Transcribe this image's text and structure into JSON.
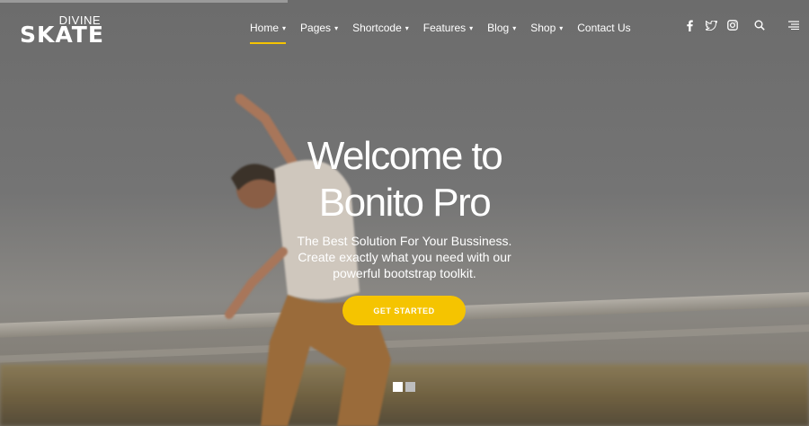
{
  "brand": {
    "top": "DIVINE",
    "main": "SKATE"
  },
  "nav": {
    "items": [
      {
        "label": "Home",
        "dropdown": true,
        "active": true
      },
      {
        "label": "Pages",
        "dropdown": true
      },
      {
        "label": "Shortcode",
        "dropdown": true
      },
      {
        "label": "Features",
        "dropdown": true
      },
      {
        "label": "Blog",
        "dropdown": true
      },
      {
        "label": "Shop",
        "dropdown": true
      },
      {
        "label": "Contact Us",
        "dropdown": false
      }
    ],
    "caret": "▾"
  },
  "icons": [
    "facebook-icon",
    "twitter-icon",
    "instagram-icon",
    "search-icon",
    "menu-icon"
  ],
  "hero": {
    "title_line1": "Welcome to",
    "title_line2": "Bonito Pro",
    "sub_line1": "The Best Solution For Your Bussiness.",
    "sub_line2": "Create exactly what you need with our",
    "sub_line3": "powerful bootstrap toolkit.",
    "cta": "GET STARTED"
  },
  "slider": {
    "count": 2,
    "active": 1
  },
  "colors": {
    "accent": "#f5c400",
    "text": "#ffffff"
  }
}
